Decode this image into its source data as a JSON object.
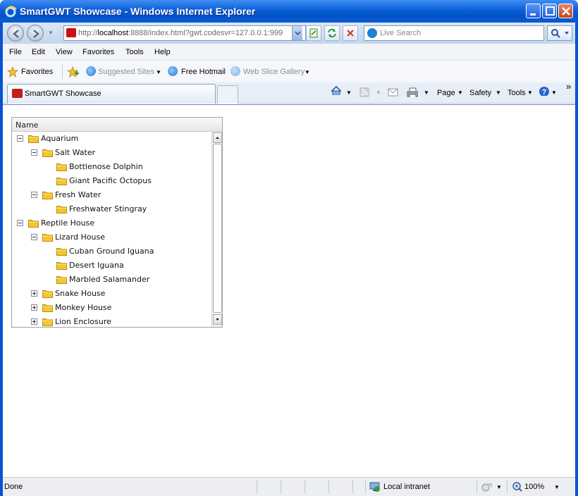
{
  "window": {
    "title": "SmartGWT Showcase - Windows Internet Explorer"
  },
  "address": {
    "url_prefix": "http://",
    "url_host": "localhost",
    "url_rest": ":8888/index.html?gwt.codesvr=127.0.0.1:999",
    "search_placeholder": "Live Search"
  },
  "menu": {
    "items": [
      "File",
      "Edit",
      "View",
      "Favorites",
      "Tools",
      "Help"
    ]
  },
  "favorites_bar": {
    "favorites_label": "Favorites",
    "suggested_sites": "Suggested Sites",
    "free_hotmail": "Free Hotmail",
    "web_slice_gallery": "Web Slice Gallery"
  },
  "tabs": {
    "active_label": "SmartGWT Showcase"
  },
  "command_bar": {
    "page": "Page",
    "safety": "Safety",
    "tools": "Tools",
    "overflow": "»"
  },
  "tree": {
    "header": "Name",
    "rows": [
      {
        "label": "Aquarium",
        "state": "open"
      },
      {
        "label": "Salt Water",
        "state": "open"
      },
      {
        "label": "Bottlenose Dolphin",
        "state": "leaf"
      },
      {
        "label": "Giant Pacific Octopus",
        "state": "leaf"
      },
      {
        "label": "Fresh Water",
        "state": "open"
      },
      {
        "label": "Freshwater Stingray",
        "state": "leaf"
      },
      {
        "label": "Reptile House",
        "state": "open"
      },
      {
        "label": "Lizard House",
        "state": "open"
      },
      {
        "label": "Cuban Ground Iguana",
        "state": "leaf"
      },
      {
        "label": "Desert Iguana",
        "state": "leaf"
      },
      {
        "label": "Marbled Salamander",
        "state": "leaf"
      },
      {
        "label": "Snake House",
        "state": "closed"
      },
      {
        "label": "Monkey House",
        "state": "closed"
      },
      {
        "label": "Lion Enclosure",
        "state": "closed"
      }
    ]
  },
  "status": {
    "text": "Done",
    "zone": "Local intranet",
    "zoom": "100%"
  },
  "colors": {
    "titlebar": "#0a5fd8",
    "folder": "#f5c72c"
  }
}
